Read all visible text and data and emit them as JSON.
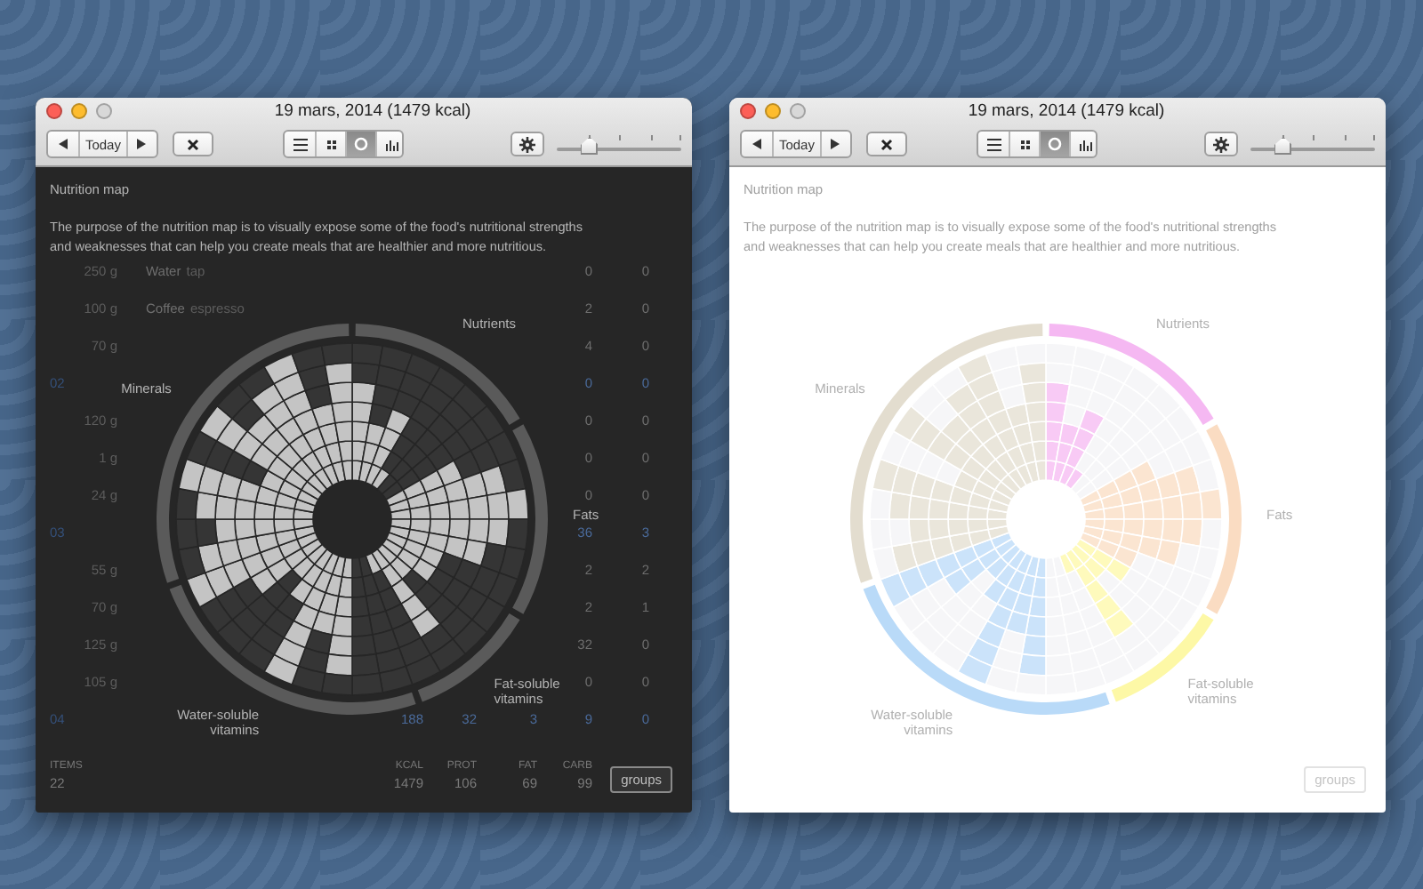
{
  "windows": [
    {
      "kind": "dark",
      "title": "19 mars, 2014 (1479 kcal)",
      "today": "Today",
      "views": [
        {
          "kind": "list",
          "selected": false
        },
        {
          "kind": "grid",
          "selected": false
        },
        {
          "kind": "map",
          "selected": true
        },
        {
          "kind": "bars",
          "selected": false
        }
      ],
      "zoom": {
        "level": 0.26
      },
      "table": {
        "rows": [
          {
            "kind": "item",
            "quantity": "250 g",
            "name": "Water",
            "note": "tap",
            "carb": "0",
            "fibr": "0"
          },
          {
            "kind": "item",
            "quantity": "100 g",
            "name": "Coffee",
            "note": "espresso",
            "carb": "2",
            "fibr": "0"
          },
          {
            "kind": "item",
            "quantity": "70 g",
            "carb": "4",
            "fibr": "0"
          },
          {
            "kind": "group",
            "number": "02",
            "carb": "0",
            "fibr": "0"
          },
          {
            "kind": "item",
            "quantity": "120 g",
            "carb": "0",
            "fibr": "0"
          },
          {
            "kind": "item",
            "quantity": "1 g",
            "carb": "0",
            "fibr": "0"
          },
          {
            "kind": "item",
            "quantity": "24 g",
            "carb": "0",
            "fibr": "0"
          },
          {
            "kind": "group",
            "number": "03",
            "carb": "36",
            "fibr": "3"
          },
          {
            "kind": "item",
            "quantity": "55 g",
            "carb": "2",
            "fibr": "2"
          },
          {
            "kind": "item",
            "quantity": "70 g",
            "carb": "2",
            "fibr": "1"
          },
          {
            "kind": "item",
            "quantity": "125 g",
            "carb": "32",
            "fibr": "0"
          },
          {
            "kind": "item",
            "quantity": "105 g",
            "carb": "0",
            "fibr": "0"
          },
          {
            "kind": "group",
            "number": "04",
            "kcal": "188",
            "prot": "32",
            "fat": "3",
            "carb": "9",
            "fibr": "0"
          }
        ],
        "footer": {
          "items_label": "ITEMS",
          "items": "22",
          "columns": [
            {
              "label": "KCAL",
              "value": "1479"
            },
            {
              "label": "PROT",
              "value": "106"
            },
            {
              "label": "FAT",
              "value": "69"
            },
            {
              "label": "CARB",
              "value": "99"
            }
          ]
        }
      },
      "map": {
        "title": "Nutrition map",
        "description": "The purpose of the nutrition map is to visually expose some of the food's nutritional strengths and weaknesses that can help you create meals that are healthier and more nutritious.",
        "groups": [
          {
            "label": "Nutrients"
          },
          {
            "label": "Fats"
          },
          {
            "label": "Fat-soluble vitamins"
          },
          {
            "label": "Water-soluble vitamins"
          },
          {
            "label": "Minerals"
          }
        ]
      },
      "groups_button": "groups"
    },
    {
      "kind": "light",
      "title": "19 mars, 2014 (1479 kcal)",
      "today": "Today",
      "views": [
        {
          "kind": "list",
          "selected": false
        },
        {
          "kind": "grid",
          "selected": false
        },
        {
          "kind": "map",
          "selected": true
        },
        {
          "kind": "bars",
          "selected": false
        }
      ],
      "zoom": {
        "level": 0.26
      },
      "map": {
        "title": "Nutrition map",
        "description": "The purpose of the nutrition map is to visually expose some of the food's nutritional strengths and weaknesses that can help you create meals that are healthier and more nutritious.",
        "groups": [
          {
            "label": "Nutrients",
            "color": "#f5b8f2"
          },
          {
            "label": "Fats",
            "color": "#fadcc2"
          },
          {
            "label": "Fat-soluble vitamins",
            "color": "#fdf8a6"
          },
          {
            "label": "Water-soluble vitamins",
            "color": "#b9daf8"
          },
          {
            "label": "Minerals",
            "color": "#e3ddcf"
          }
        ]
      },
      "groups_button": "groups"
    }
  ]
}
